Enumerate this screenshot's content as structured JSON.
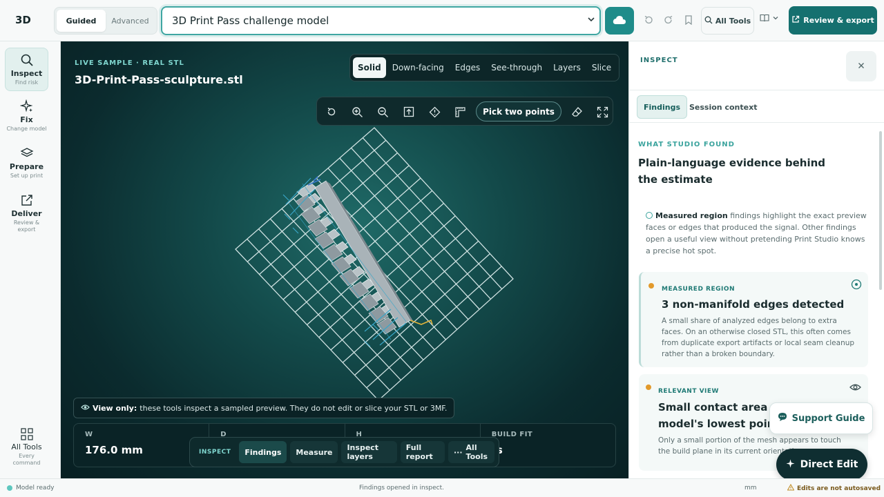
{
  "app": {
    "logo": "3D"
  },
  "mode_toggle": {
    "guided": "Guided",
    "advanced": "Advanced"
  },
  "model_select": {
    "value": "3D Print Pass challenge model"
  },
  "toolbar": {
    "all_tools": "All Tools",
    "review_export": "Review & export"
  },
  "rail": {
    "items": [
      {
        "label": "Inspect",
        "sub": "Find risk"
      },
      {
        "label": "Fix",
        "sub": "Change model"
      },
      {
        "label": "Prepare",
        "sub": "Set up print"
      },
      {
        "label": "Deliver",
        "sub": "Review & export"
      },
      {
        "label": "All Tools",
        "sub": "Every command"
      }
    ]
  },
  "viewport": {
    "live_label": "LIVE SAMPLE · REAL STL",
    "file_name": "3D-Print-Pass-sculpture.stl",
    "view_modes": [
      "Solid",
      "Down-facing",
      "Edges",
      "See-through",
      "Layers",
      "Slice"
    ],
    "pick_two_points": "Pick two points",
    "view_only_bold": "View only:",
    "view_only_text": "these tools inspect a sampled preview. They do not edit or slice your STL or 3MF.",
    "dims": [
      {
        "label": "W",
        "value": "176.0 mm"
      },
      {
        "label": "D",
        "value": ""
      },
      {
        "label": "H",
        "value": ""
      },
      {
        "label": "BUILD FIT",
        "value": "ts"
      }
    ],
    "inspect_bar": {
      "label": "INSPECT",
      "buttons": [
        "Findings",
        "Measure",
        "Inspect layers",
        "Full report",
        "All Tools"
      ]
    }
  },
  "panel": {
    "head": "INSPECT",
    "tabs": [
      "Findings",
      "Session context"
    ],
    "found_head": "WHAT STUDIO FOUND",
    "found_title": "Plain-language evidence behind the estimate",
    "note_bold": "Measured region",
    "note_text": "findings highlight the exact preview faces or edges that produced the signal. Other findings open a useful view without pretending Print Studio knows a precise hot spot.",
    "cards": [
      {
        "kicker": "MEASURED REGION",
        "title": "3 non-manifold edges detected",
        "body": "A small share of analyzed edges belong to extra faces. On an otherwise closed STL, this often comes from duplicate export artifacts or local seam cleanup rather than a broken boundary."
      },
      {
        "kicker": "RELEVANT VIEW",
        "title": "Small contact area at the model's lowest point",
        "body": "Only a small portion of the mesh appears to touch the build plane in its current orientation."
      }
    ]
  },
  "floating": {
    "support": "Support Guide",
    "direct_edit": "Direct Edit"
  },
  "status": {
    "left": "Model ready",
    "center": "Findings opened in inspect.",
    "unit": "mm",
    "right": "Edits are not autosaved"
  },
  "colors": {
    "accent": "#15706f",
    "viewport_bg": "#0b2b2e",
    "warning_dot": "#e29a2c"
  }
}
